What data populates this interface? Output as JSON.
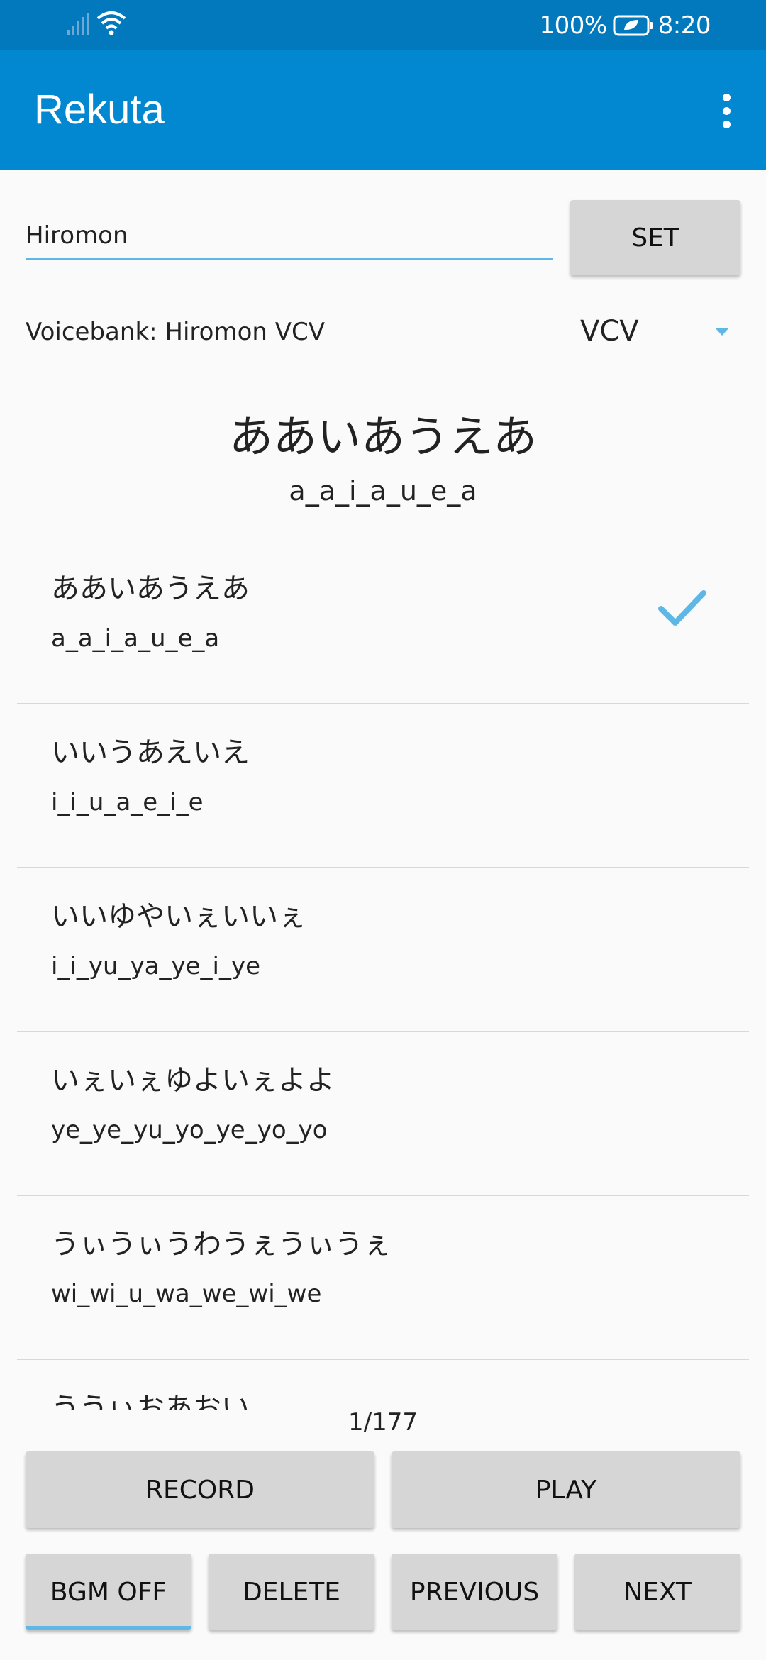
{
  "status_bar": {
    "battery": "100%",
    "time": "8:20"
  },
  "app_bar": {
    "title": "Rekuta"
  },
  "name_field": {
    "value": "Hiromon"
  },
  "set_button": {
    "label": "SET"
  },
  "voicebank": {
    "label": "Voicebank: Hiromon VCV"
  },
  "type_select": {
    "selected": "VCV"
  },
  "current": {
    "kana": "ああいあうえあ",
    "romaji": "a_a_i_a_u_e_a"
  },
  "list": {
    "items": [
      {
        "kana": "ああいあうえあ",
        "romaji": "a_a_i_a_u_e_a",
        "recorded": true
      },
      {
        "kana": "いいうあえいえ",
        "romaji": "i_i_u_a_e_i_e",
        "recorded": false
      },
      {
        "kana": "いいゆやいぇいいぇ",
        "romaji": "i_i_yu_ya_ye_i_ye",
        "recorded": false
      },
      {
        "kana": "いぇいぇゆよいぇよよ",
        "romaji": "ye_ye_yu_yo_ye_yo_yo",
        "recorded": false
      },
      {
        "kana": "うぃうぃうわうぇうぃうぇ",
        "romaji": "wi_wi_u_wa_we_wi_we",
        "recorded": false
      },
      {
        "kana": "ううぃおあおい",
        "romaji": "",
        "recorded": false
      }
    ]
  },
  "counter": "1/177",
  "controls": {
    "record": "RECORD",
    "play": "PLAY",
    "bgm": "BGM OFF",
    "delete": "DELETE",
    "previous": "PREVIOUS",
    "next": "NEXT"
  },
  "colors": {
    "primary": "#0288d1",
    "primary_dark": "#0278bd",
    "accent": "#5fb7e5"
  }
}
